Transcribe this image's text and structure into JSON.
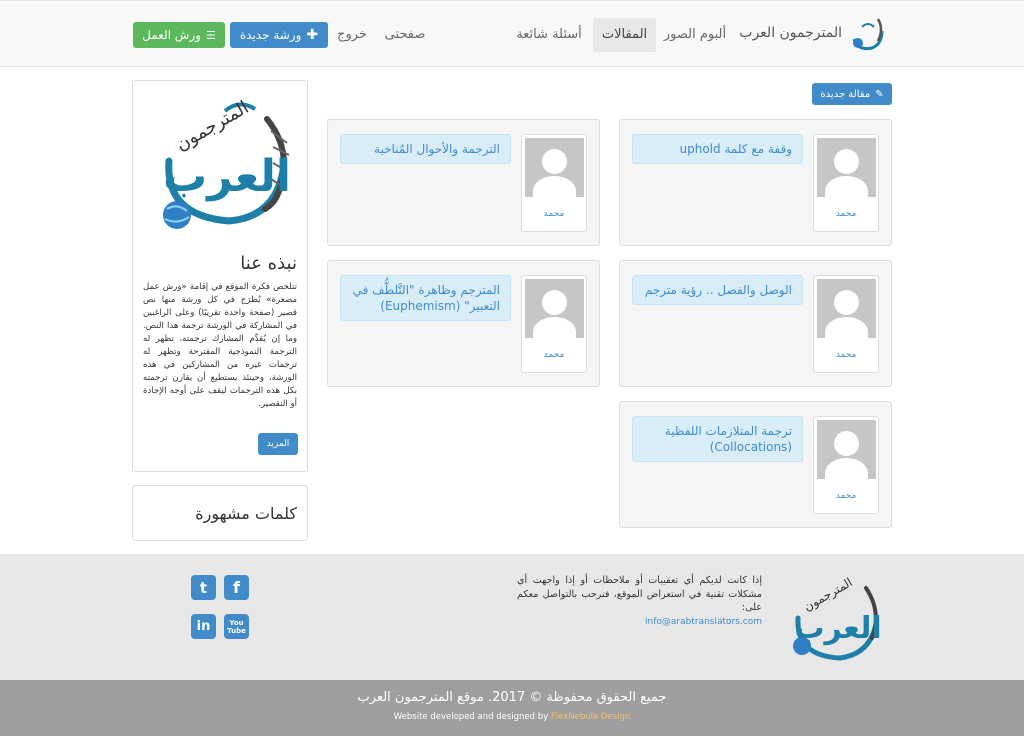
{
  "brand": {
    "name": "المترجمون العرب"
  },
  "nav": {
    "articles": "المقالات",
    "album": "ألبوم الصور",
    "faq": "أسئلة شائعة",
    "my_page": "صفحتى",
    "logout": "خروج",
    "new_workshop": "ورشة جديدة",
    "workshops": "ورش العمل"
  },
  "new_article_label": "مقالة جديدة",
  "articles": [
    {
      "title": "وقفة مع كلمة uphold",
      "author": "محمد"
    },
    {
      "title": "الترجمة والأحوال المُناخية",
      "author": "محمد"
    },
    {
      "title": "الوصل والفصل .. رؤية مترجم",
      "author": "محمد"
    },
    {
      "title": "المترجم وظاهرة \"التَّلطُّف في التعبير\" (Euphemism)",
      "author": "محمد"
    },
    {
      "title": "ترجمة المتلازمات اللفظية (Collocations)",
      "author": "محمد"
    }
  ],
  "sidebar": {
    "about_title": "نبذه عنا",
    "about_text": "تتلخص فكرة الموقع في إقامة «ورش عمل مصغرة» يُطرَح في كل ورشة منها نص قصير (صفحة واحدة تقريبًا) وعلى الراغبين في المشاركة في الورشة ترجمة هذا النص. وما إن يُقدِّم المشارك ترجمته، تظهر له الترجمة النموذجية المقترحة وتظهر له ترجمات غيره من المشاركين في هذه الورشة، وحينئذ يستطيع أن يقارن ترجمته بكل هذه الترجمات ليقف على أوجه الإجادة أو التقصير.",
    "more_label": "المزيد",
    "popular_title": "كلمات مشهورة"
  },
  "footer": {
    "contact_text": "إذا كانت لديكم أي تعقيبات أو ملاحظات أو إذا واجهت أي مشكلات تقنية في استعراض الموقع، فنرحب بالتواصل معكم على:",
    "email": "info@arabtranslators.com",
    "copyright": "جميع الحقوق محفوظة © 2017. موقع المترجمون العرب",
    "credit_prefix": "Website developed and designed by ",
    "credit_link": "FlexNebula Design",
    "social": {
      "twitter": "t",
      "facebook": "f",
      "linkedin": "in",
      "youtube": "You Tube"
    }
  },
  "colors": {
    "primary": "#428bca",
    "success": "#5cb85c",
    "accent_logo": "#1e7fa8",
    "card_bg": "#f5f5f5",
    "title_bg": "#d9edf7"
  }
}
